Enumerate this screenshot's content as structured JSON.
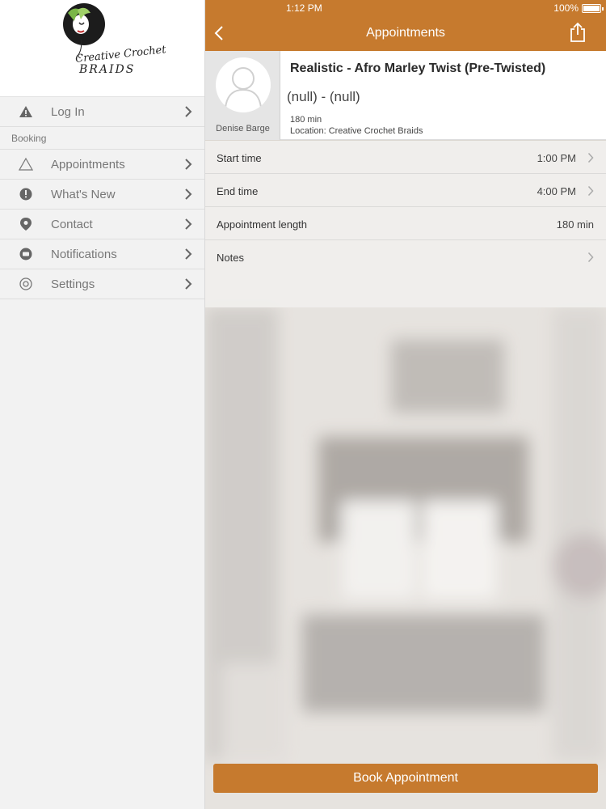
{
  "status_bar": {
    "time": "1:12 PM",
    "battery": "100%"
  },
  "nav": {
    "title": "Appointments"
  },
  "sidebar": {
    "logo": {
      "line1": "Creative Crochet",
      "line2": "BRAIDS"
    },
    "login_label": "Log In",
    "section_label": "Booking",
    "items": [
      {
        "label": "Appointments",
        "icon": "triangle-outline-icon"
      },
      {
        "label": "What's New",
        "icon": "exclamation-circle-icon"
      },
      {
        "label": "Contact",
        "icon": "location-pin-icon"
      },
      {
        "label": "Notifications",
        "icon": "chat-bubble-icon"
      },
      {
        "label": "Settings",
        "icon": "gear-icon"
      }
    ]
  },
  "service": {
    "title": "Realistic - Afro Marley Twist (Pre-Twisted)",
    "subtitle": "(null) - (null)",
    "duration": "180 min",
    "location": "Location: Creative Crochet Braids",
    "staff_name": "Denise Barge"
  },
  "details": [
    {
      "label": "Start time",
      "value": "1:00 PM"
    },
    {
      "label": "End time",
      "value": "4:00 PM"
    },
    {
      "label": "Appointment length",
      "value": "180 min"
    },
    {
      "label": "Notes",
      "value": ""
    }
  ],
  "book_button": "Book Appointment",
  "colors": {
    "accent": "#c67a2e",
    "sidebar_bg": "#f2f2f2"
  }
}
